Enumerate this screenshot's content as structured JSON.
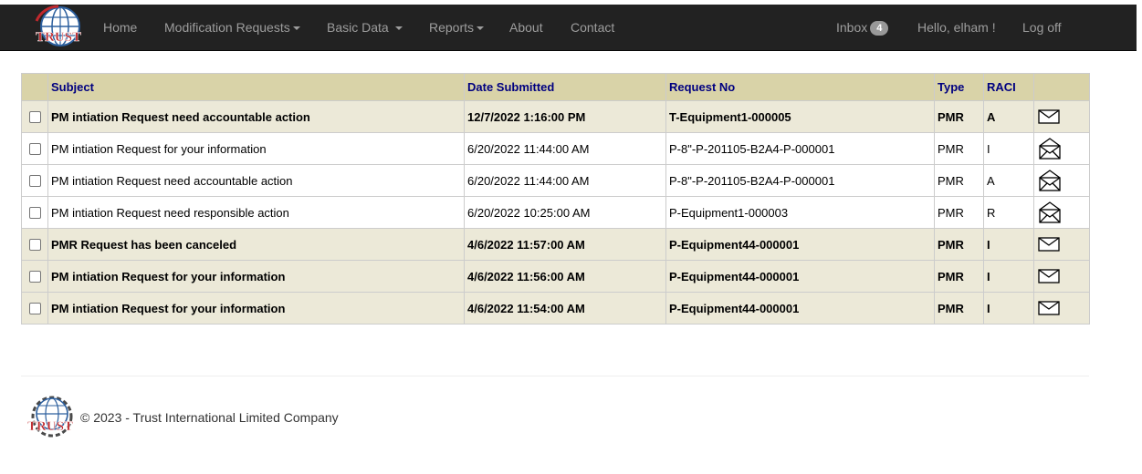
{
  "brand": {
    "logo_text": "TRUST"
  },
  "nav": {
    "home": "Home",
    "modification_requests": "Modification Requests",
    "basic_data": "Basic Data",
    "reports": "Reports",
    "about": "About",
    "contact": "Contact",
    "inbox": "Inbox",
    "inbox_count": "4",
    "greeting": "Hello, elham !",
    "logoff": "Log off"
  },
  "table": {
    "headers": [
      "",
      "Subject",
      "Date Submitted",
      "Request No",
      "Type",
      "RACI",
      ""
    ],
    "rows": [
      {
        "subject": "PM intiation Request need accountable action",
        "date": "12/7/2022 1:16:00 PM",
        "request_no": "T-Equipment1-000005",
        "type": "PMR",
        "raci": "A",
        "read": false,
        "icon": "envelope-closed-icon"
      },
      {
        "subject": "PM intiation Request for your information",
        "date": "6/20/2022 11:44:00 AM",
        "request_no": "P-8\"-P-201105-B2A4-P-000001",
        "type": "PMR",
        "raci": "I",
        "read": true,
        "icon": "envelope-open-icon"
      },
      {
        "subject": "PM intiation Request need accountable action",
        "date": "6/20/2022 11:44:00 AM",
        "request_no": "P-8\"-P-201105-B2A4-P-000001",
        "type": "PMR",
        "raci": "A",
        "read": true,
        "icon": "envelope-open-icon"
      },
      {
        "subject": "PM intiation Request need responsible action",
        "date": "6/20/2022 10:25:00 AM",
        "request_no": "P-Equipment1-000003",
        "type": "PMR",
        "raci": "R",
        "read": true,
        "icon": "envelope-open-icon"
      },
      {
        "subject": "PMR Request has been canceled",
        "date": "4/6/2022 11:57:00 AM",
        "request_no": "P-Equipment44-000001",
        "type": "PMR",
        "raci": "I",
        "read": false,
        "icon": "envelope-closed-icon"
      },
      {
        "subject": "PM intiation Request for your information",
        "date": "4/6/2022 11:56:00 AM",
        "request_no": "P-Equipment44-000001",
        "type": "PMR",
        "raci": "I",
        "read": false,
        "icon": "envelope-closed-icon"
      },
      {
        "subject": "PM intiation Request for your information",
        "date": "4/6/2022 11:54:00 AM",
        "request_no": "P-Equipment44-000001",
        "type": "PMR",
        "raci": "I",
        "read": false,
        "icon": "envelope-closed-icon"
      }
    ]
  },
  "footer": {
    "text": "© 2023 - Trust International Limited Company"
  },
  "colors": {
    "navbar_bg": "#222222",
    "nav_text": "#9d9d9d",
    "header_bg": "#d9d3a8",
    "header_text": "#000080",
    "unread_row_bg": "#ece9d8",
    "logo_red": "#c0282d",
    "logo_blue": "#2c5f9e"
  }
}
